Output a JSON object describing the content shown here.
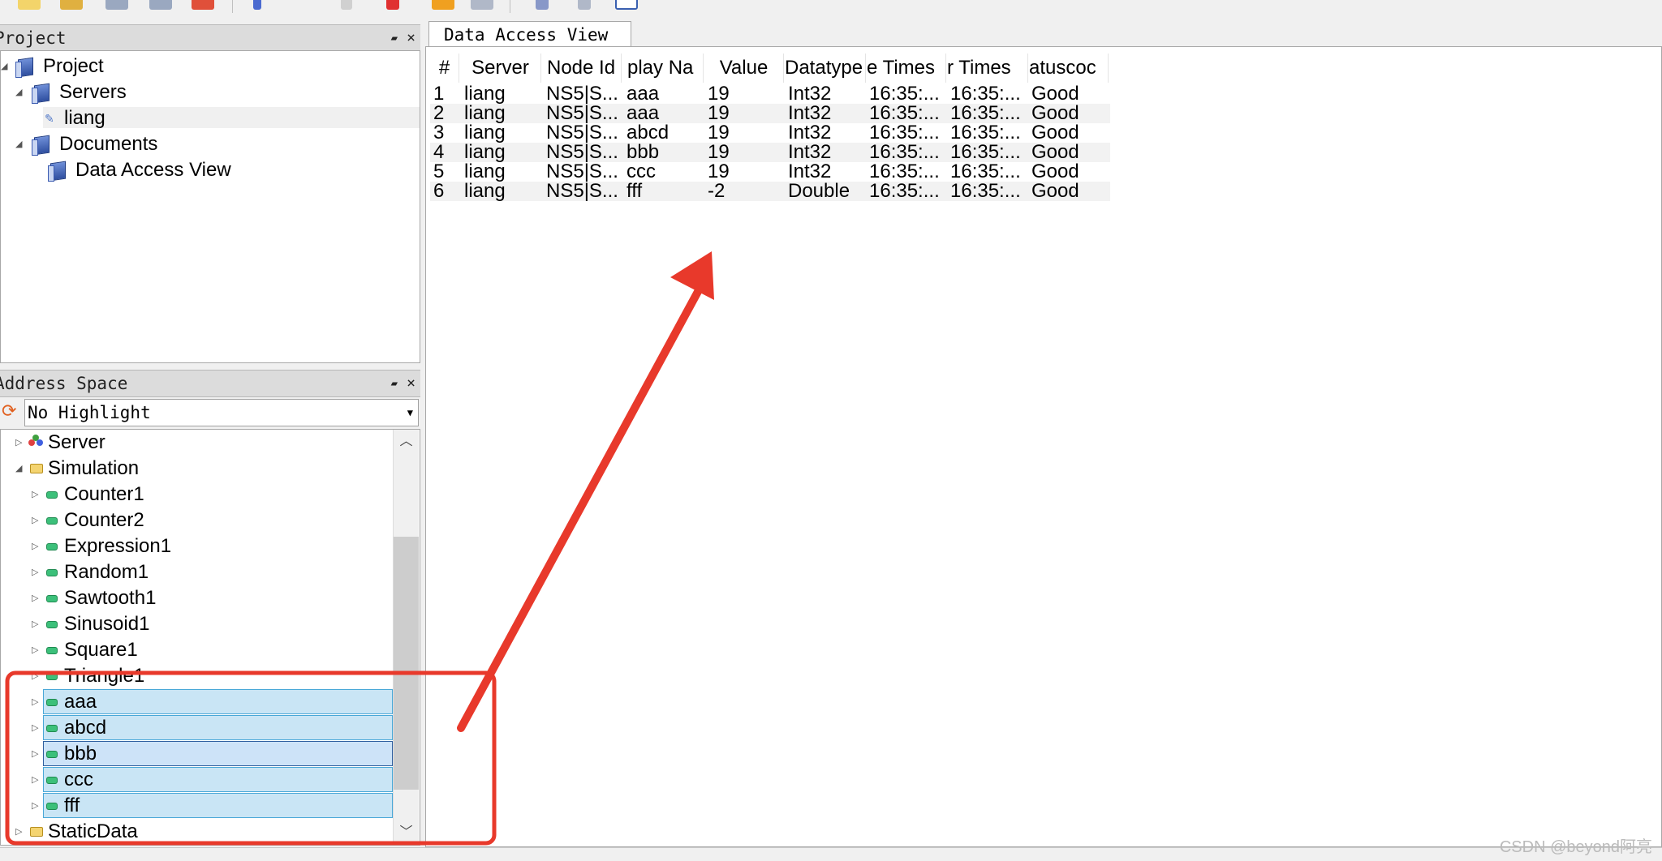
{
  "project_panel": {
    "title": "Project",
    "tree": [
      {
        "label": "Project"
      },
      {
        "label": "Servers"
      },
      {
        "label": "liang"
      },
      {
        "label": "Documents"
      },
      {
        "label": "Data Access View"
      }
    ]
  },
  "address_space": {
    "title": "Address Space",
    "highlight_select": "No Highlight",
    "tree": [
      {
        "label": "Server"
      },
      {
        "label": "Simulation"
      },
      {
        "label": "Counter1"
      },
      {
        "label": "Counter2"
      },
      {
        "label": "Expression1"
      },
      {
        "label": "Random1"
      },
      {
        "label": "Sawtooth1"
      },
      {
        "label": "Sinusoid1"
      },
      {
        "label": "Square1"
      },
      {
        "label": "Triangle1"
      },
      {
        "label": "aaa"
      },
      {
        "label": "abcd"
      },
      {
        "label": "bbb"
      },
      {
        "label": "ccc"
      },
      {
        "label": "fff"
      },
      {
        "label": "StaticData"
      }
    ]
  },
  "data_access_view": {
    "tab_label": "Data Access View",
    "columns": [
      "#",
      "Server",
      "Node Id",
      "play Na",
      "Value",
      "Datatype",
      "e Times",
      "r Times",
      "atuscoc"
    ],
    "rows": [
      [
        "1",
        "liang",
        "NS5|S...",
        "aaa",
        "19",
        "Int32",
        "16:35:...",
        "16:35:...",
        "Good"
      ],
      [
        "2",
        "liang",
        "NS5|S...",
        "aaa",
        "19",
        "Int32",
        "16:35:...",
        "16:35:...",
        "Good"
      ],
      [
        "3",
        "liang",
        "NS5|S...",
        "abcd",
        "19",
        "Int32",
        "16:35:...",
        "16:35:...",
        "Good"
      ],
      [
        "4",
        "liang",
        "NS5|S...",
        "bbb",
        "19",
        "Int32",
        "16:35:...",
        "16:35:...",
        "Good"
      ],
      [
        "5",
        "liang",
        "NS5|S...",
        "ccc",
        "19",
        "Int32",
        "16:35:...",
        "16:35:...",
        "Good"
      ],
      [
        "6",
        "liang",
        "NS5|S...",
        "fff",
        "-2",
        "Double",
        "16:35:...",
        "16:35:...",
        "Good"
      ]
    ]
  },
  "watermark": "CSDN @beyond阿亮",
  "colors": {
    "annotation_red": "#e8392b",
    "selection_fill": "#c9e5f5",
    "selection_border": "#4aa8d8"
  }
}
